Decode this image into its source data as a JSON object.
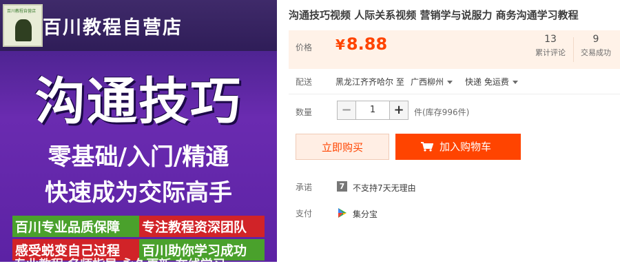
{
  "image": {
    "logo_small_text": "百川教程自营店",
    "shop_title": "百川教程自营店",
    "big_title": "沟通技巧",
    "line1": "零基础/入门/精通",
    "line2": "快速成为交际高手",
    "tags": [
      {
        "text": "百川专业品质保障",
        "color": "green"
      },
      {
        "text": "专注教程资深团队",
        "color": "red"
      },
      {
        "text": "感受蜕变自己过程",
        "color": "red"
      },
      {
        "text": "百川助你学习成功",
        "color": "green"
      }
    ],
    "cut_text": "专业教程  名师指导  永久更新  在线学习"
  },
  "product": {
    "title": "沟通技巧视频 人际关系视频 营销学与说服力 商务沟通学习教程",
    "price_label": "价格",
    "currency": "¥",
    "price": "8.88",
    "stats": [
      {
        "value": "13",
        "label": "累计评论"
      },
      {
        "value": "9",
        "label": "交易成功"
      }
    ]
  },
  "delivery": {
    "label": "配送",
    "from": "黑龙江齐齐哈尔 至",
    "to": "广西柳州",
    "method": "快递 免运费"
  },
  "quantity": {
    "label": "数量",
    "minus": "−",
    "value": "1",
    "plus": "+",
    "stock": "件(库存996件)"
  },
  "actions": {
    "buy_now": "立即购买",
    "add_to_cart": "加入购物车"
  },
  "promise": {
    "label": "承诺",
    "icon_text": "7",
    "text": "不支持7天无理由"
  },
  "payment": {
    "label": "支付",
    "text": "集分宝"
  },
  "colors": {
    "accent": "#ff4400",
    "price_bg": "#fff2e8"
  }
}
